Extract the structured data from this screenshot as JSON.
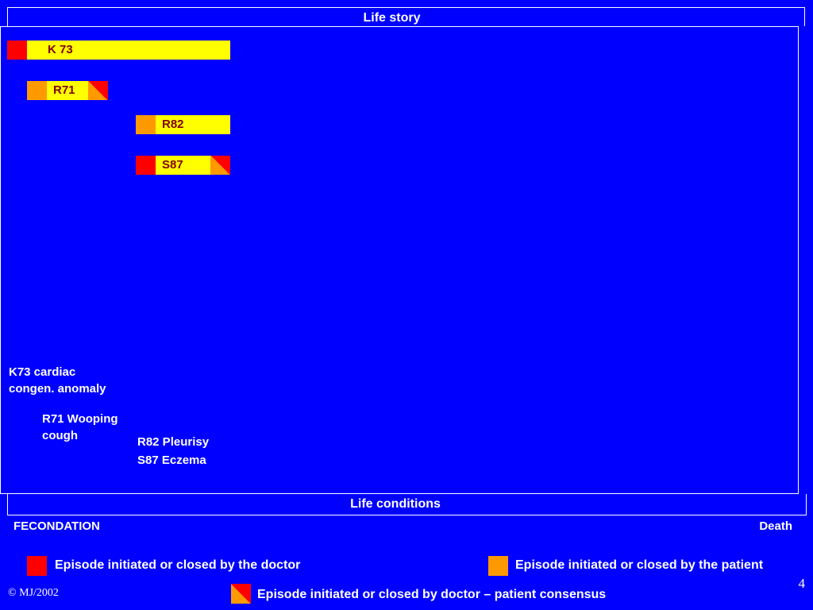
{
  "header": {
    "title": "Life story"
  },
  "footer": {
    "title": "Life conditions",
    "start_label": "FECONDATION",
    "end_label": "Death"
  },
  "episodes": [
    {
      "code": "K 73"
    },
    {
      "code": "R71"
    },
    {
      "code": "R82"
    },
    {
      "code": "S87"
    }
  ],
  "notes": {
    "k73_line1": "K73 cardiac",
    "k73_line2": "congen. anomaly",
    "r71_line1": "R71 Wooping",
    "r71_line2": "cough",
    "r82": "R82 Pleurisy",
    "s87": "S87 Eczema"
  },
  "legend": {
    "doctor": "Episode initiated or closed by the doctor",
    "patient": "Episode initiated or closed by the patient",
    "consensus": "Episode initiated or closed  by doctor – patient consensus"
  },
  "copyright": "© MJ/2002",
  "page_number": "4",
  "colors": {
    "background": "#0000ff",
    "doctor": "#ff0000",
    "patient": "#ff9900",
    "episode_bar": "#ffff00",
    "code_text": "#800000"
  }
}
